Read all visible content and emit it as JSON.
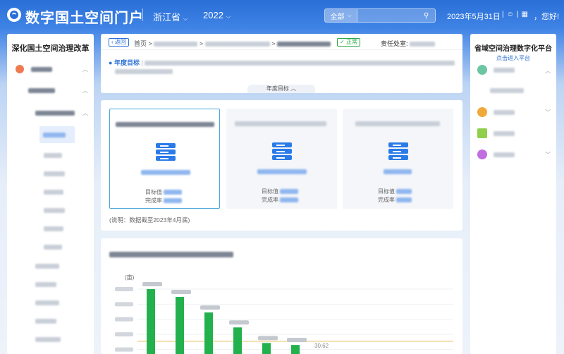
{
  "header": {
    "title": "数字国土空间门户",
    "province": "浙江省",
    "year": "2022",
    "search_scope": "全部",
    "search_placeholder": "",
    "date": "2023年5月31日",
    "greeting": "，您好!"
  },
  "left_panel": {
    "title": "深化国土空间治理改革"
  },
  "breadcrumb": {
    "back": "返回",
    "home": "首页",
    "status": "正常",
    "dept_label": "责任处室:"
  },
  "annual_goal": {
    "label": "年度目标",
    "tab": "年度目标"
  },
  "cards": [
    {
      "target_label": "目标值",
      "rate_label": "完成率"
    },
    {
      "target_label": "目标值",
      "rate_label": "完成率"
    },
    {
      "target_label": "目标值",
      "rate_label": "完成率"
    }
  ],
  "note": "(说明：数据截至2023年4月底)",
  "right_panel": {
    "title": "省域空间治理数字化平台",
    "link": "点击进入平台"
  },
  "chart_data": {
    "type": "bar",
    "unit_label": "(亩)",
    "values": [
      100,
      88,
      64,
      41,
      17,
      14
    ],
    "data_labels": [
      "",
      "",
      "",
      "",
      "",
      "",
      "",
      "30.62"
    ],
    "bar_color": "#23b14d",
    "reference_line_color": "#e8c46a"
  }
}
